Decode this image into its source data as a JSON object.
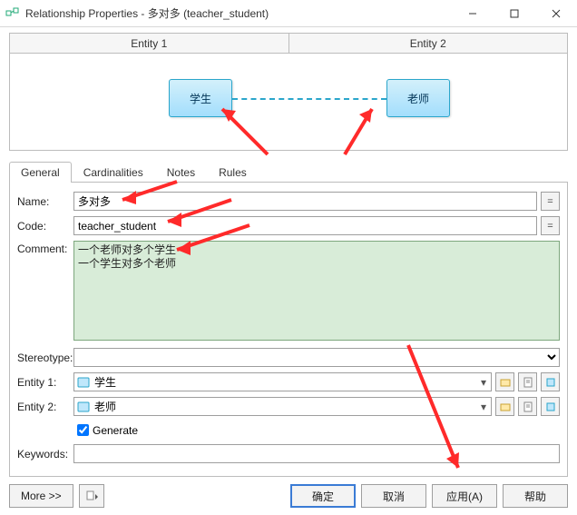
{
  "title": "Relationship Properties - 多对多 (teacher_student)",
  "diagram": {
    "entity1_header": "Entity 1",
    "entity2_header": "Entity 2",
    "node_left": "学生",
    "node_right": "老师"
  },
  "tabs": {
    "general": "General",
    "cardinalities": "Cardinalities",
    "notes": "Notes",
    "rules": "Rules"
  },
  "form": {
    "name_label": "Name:",
    "name_value": "多对多",
    "code_label": "Code:",
    "code_value": "teacher_student",
    "comment_label": "Comment:",
    "comment_value": "一个老师对多个学生\n一个学生对多个老师",
    "stereotype_label": "Stereotype:",
    "stereotype_value": "",
    "entity1_label": "Entity 1:",
    "entity1_value": "学生",
    "entity2_label": "Entity 2:",
    "entity2_value": "老师",
    "generate_label": "Generate",
    "keywords_label": "Keywords:",
    "keywords_value": "",
    "eq_btn": "="
  },
  "footer": {
    "more": "More >>",
    "ok": "确定",
    "cancel": "取消",
    "apply": "应用(A)",
    "help": "帮助"
  }
}
